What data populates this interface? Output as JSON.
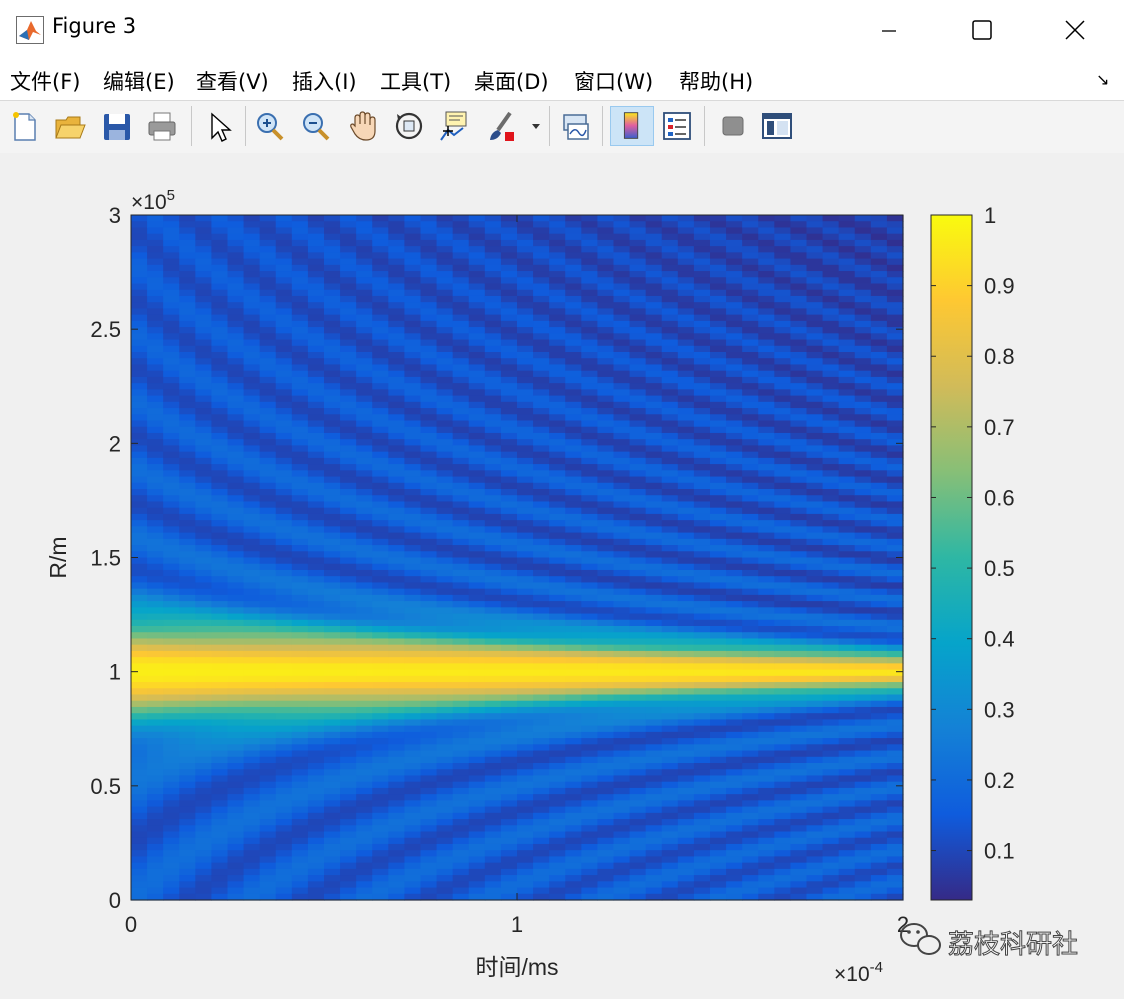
{
  "window": {
    "title": "Figure 3"
  },
  "menu": [
    {
      "label": "文件(F)"
    },
    {
      "label": "编辑(E)"
    },
    {
      "label": "查看(V)"
    },
    {
      "label": "插入(I)"
    },
    {
      "label": "工具(T)"
    },
    {
      "label": "桌面(D)"
    },
    {
      "label": "窗口(W)"
    },
    {
      "label": "帮助(H)"
    }
  ],
  "toolbar": {
    "icons": [
      "new-figure-icon",
      "open-file-icon",
      "save-icon",
      "print-icon",
      "select-arrow-icon",
      "zoom-in-icon",
      "zoom-out-icon",
      "pan-hand-icon",
      "rotate-3d-icon",
      "data-cursor-icon",
      "brush-icon",
      "link-plot-icon",
      "colorbar-icon",
      "legend-icon",
      "hide-plot-tools-icon",
      "show-plot-tools-icon"
    ]
  },
  "watermark": {
    "text": "荔枝科研社"
  },
  "chart_data": {
    "type": "heatmap",
    "xlabel": "时间/ms",
    "ylabel": "R/m",
    "xlim": [
      0,
      0.0002
    ],
    "ylim": [
      0,
      300000
    ],
    "x_ticks": [
      {
        "value": 0,
        "label": "0"
      },
      {
        "value": 0.0001,
        "label": "1"
      },
      {
        "value": 0.0002,
        "label": "2"
      }
    ],
    "x_exponent_label": "×10",
    "x_exponent": "-4",
    "y_ticks": [
      {
        "value": 0,
        "label": "0"
      },
      {
        "value": 50000,
        "label": "0.5"
      },
      {
        "value": 100000,
        "label": "1"
      },
      {
        "value": 150000,
        "label": "1.5"
      },
      {
        "value": 200000,
        "label": "2"
      },
      {
        "value": 250000,
        "label": "2.5"
      },
      {
        "value": 300000,
        "label": "3"
      }
    ],
    "y_exponent_label": "×10",
    "y_exponent": "5",
    "peak_range_m": 100000,
    "colorbar": {
      "colormap": "parula",
      "range": [
        0.03,
        1
      ],
      "ticks": [
        {
          "value": 0.1,
          "label": "0.1"
        },
        {
          "value": 0.2,
          "label": "0.2"
        },
        {
          "value": 0.3,
          "label": "0.3"
        },
        {
          "value": 0.4,
          "label": "0.4"
        },
        {
          "value": 0.5,
          "label": "0.5"
        },
        {
          "value": 0.6,
          "label": "0.6"
        },
        {
          "value": 0.7,
          "label": "0.7"
        },
        {
          "value": 0.8,
          "label": "0.8"
        },
        {
          "value": 0.9,
          "label": "0.9"
        },
        {
          "value": 1,
          "label": "1"
        }
      ]
    }
  }
}
